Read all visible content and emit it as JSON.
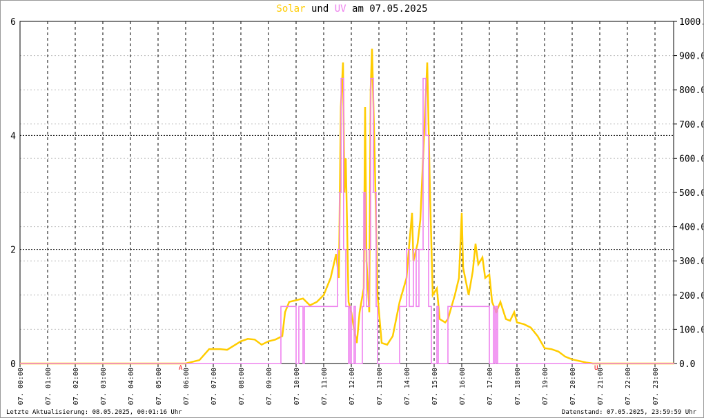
{
  "title": {
    "solar": "Solar",
    "und": "und",
    "uv": "UV",
    "date": "am 07.05.2025"
  },
  "footer": {
    "left": "Letzte Aktualisierung: 08.05.2025, 00:01:16 Uhr",
    "right": "Datenstand: 07.05.2025, 23:59:59 Uhr"
  },
  "markers": {
    "sunrise": "A",
    "sunset": "U"
  },
  "colors": {
    "solar": "#ffcc00",
    "uv": "#ee82ee"
  },
  "chart_data": {
    "type": "line",
    "title": "Solar und UV am 07.05.2025",
    "x_ticks": [
      "07. 00:00",
      "07. 01:00",
      "07. 02:00",
      "07. 03:00",
      "07. 04:00",
      "07. 05:00",
      "07. 06:00",
      "07. 07:00",
      "07. 08:00",
      "07. 09:00",
      "07. 10:00",
      "07. 11:00",
      "07. 12:00",
      "07. 13:00",
      "07. 14:00",
      "07. 15:00",
      "07. 16:00",
      "07. 17:00",
      "07. 18:00",
      "07. 19:00",
      "07. 20:00",
      "07. 21:00",
      "07. 22:00",
      "07. 23:00"
    ],
    "y_left": {
      "label": "UV",
      "range": [
        0,
        6
      ],
      "ticks": [
        "0",
        "2",
        "4",
        "6"
      ]
    },
    "y_right": {
      "label": "Solar",
      "range": [
        0,
        1000
      ],
      "ticks": [
        "0.0",
        "100.0",
        "200.0",
        "300.0",
        "400.0",
        "500.0",
        "600.0",
        "700.0",
        "800.0",
        "900.0",
        "1000.0"
      ]
    },
    "sunrise_hour": 5.9,
    "sunset_hour": 20.85,
    "series": [
      {
        "name": "Solar",
        "axis": "right",
        "points": [
          [
            0,
            0
          ],
          [
            6,
            0
          ],
          [
            6.5,
            10
          ],
          [
            6.85,
            42
          ],
          [
            7.25,
            42
          ],
          [
            7.5,
            40
          ],
          [
            8,
            65
          ],
          [
            8.25,
            72
          ],
          [
            8.5,
            70
          ],
          [
            8.75,
            55
          ],
          [
            9,
            65
          ],
          [
            9.25,
            70
          ],
          [
            9.5,
            80
          ],
          [
            9.6,
            150
          ],
          [
            9.75,
            180
          ],
          [
            10,
            185
          ],
          [
            10.25,
            190
          ],
          [
            10.5,
            170
          ],
          [
            10.75,
            180
          ],
          [
            11,
            200
          ],
          [
            11.25,
            250
          ],
          [
            11.45,
            320
          ],
          [
            11.55,
            250
          ],
          [
            11.62,
            750
          ],
          [
            11.7,
            880
          ],
          [
            11.75,
            500
          ],
          [
            11.8,
            600
          ],
          [
            11.9,
            180
          ],
          [
            12,
            150
          ],
          [
            12.1,
            100
          ],
          [
            12.2,
            60
          ],
          [
            12.3,
            150
          ],
          [
            12.45,
            220
          ],
          [
            12.5,
            750
          ],
          [
            12.55,
            300
          ],
          [
            12.65,
            150
          ],
          [
            12.7,
            800
          ],
          [
            12.75,
            920
          ],
          [
            12.85,
            600
          ],
          [
            12.95,
            200
          ],
          [
            13.1,
            60
          ],
          [
            13.3,
            55
          ],
          [
            13.5,
            80
          ],
          [
            13.75,
            180
          ],
          [
            14,
            250
          ],
          [
            14.1,
            350
          ],
          [
            14.2,
            440
          ],
          [
            14.25,
            300
          ],
          [
            14.4,
            350
          ],
          [
            14.5,
            420
          ],
          [
            14.6,
            600
          ],
          [
            14.75,
            880
          ],
          [
            14.85,
            500
          ],
          [
            14.95,
            200
          ],
          [
            15.1,
            220
          ],
          [
            15.2,
            130
          ],
          [
            15.4,
            120
          ],
          [
            15.5,
            130
          ],
          [
            15.75,
            200
          ],
          [
            15.9,
            250
          ],
          [
            16,
            440
          ],
          [
            16.05,
            280
          ],
          [
            16.25,
            200
          ],
          [
            16.4,
            270
          ],
          [
            16.5,
            350
          ],
          [
            16.6,
            290
          ],
          [
            16.75,
            310
          ],
          [
            16.85,
            250
          ],
          [
            17,
            260
          ],
          [
            17.1,
            180
          ],
          [
            17.25,
            150
          ],
          [
            17.4,
            180
          ],
          [
            17.6,
            130
          ],
          [
            17.75,
            125
          ],
          [
            17.9,
            150
          ],
          [
            18,
            120
          ],
          [
            18.25,
            115
          ],
          [
            18.5,
            105
          ],
          [
            18.75,
            80
          ],
          [
            19,
            45
          ],
          [
            19.25,
            42
          ],
          [
            19.5,
            35
          ],
          [
            19.75,
            20
          ],
          [
            20,
            12
          ],
          [
            20.5,
            3
          ],
          [
            20.75,
            0
          ],
          [
            23.7,
            0
          ]
        ]
      },
      {
        "name": "UV",
        "axis": "left",
        "step": true,
        "points": [
          [
            0,
            0
          ],
          [
            9.45,
            1
          ],
          [
            10,
            0
          ],
          [
            10.1,
            1
          ],
          [
            10.25,
            0
          ],
          [
            10.3,
            1
          ],
          [
            11.5,
            2
          ],
          [
            11.58,
            3
          ],
          [
            11.63,
            5
          ],
          [
            11.72,
            2
          ],
          [
            11.8,
            1
          ],
          [
            11.9,
            0
          ],
          [
            11.95,
            1
          ],
          [
            12,
            0
          ],
          [
            12.1,
            1
          ],
          [
            12.15,
            0
          ],
          [
            12.4,
            1
          ],
          [
            12.45,
            3
          ],
          [
            12.5,
            2
          ],
          [
            12.55,
            1
          ],
          [
            12.65,
            2
          ],
          [
            12.7,
            5
          ],
          [
            12.8,
            3
          ],
          [
            12.9,
            1
          ],
          [
            12.95,
            0
          ],
          [
            13.75,
            1
          ],
          [
            14,
            2
          ],
          [
            14.1,
            1
          ],
          [
            14.25,
            2
          ],
          [
            14.35,
            1
          ],
          [
            14.45,
            2
          ],
          [
            14.6,
            5
          ],
          [
            14.7,
            4
          ],
          [
            14.8,
            1
          ],
          [
            14.9,
            0
          ],
          [
            15.1,
            1
          ],
          [
            15.15,
            0
          ],
          [
            15.5,
            1
          ],
          [
            17,
            0
          ],
          [
            17.15,
            1
          ],
          [
            17.2,
            0
          ],
          [
            17.25,
            1
          ],
          [
            17.3,
            0
          ],
          [
            23.7,
            0
          ]
        ]
      }
    ]
  }
}
